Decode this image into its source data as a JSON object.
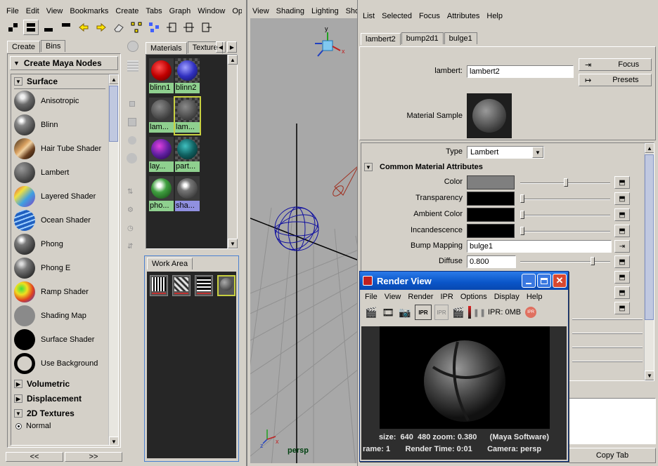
{
  "hypershade": {
    "menu": [
      "File",
      "Edit",
      "View",
      "Bookmarks",
      "Create",
      "Tabs",
      "Graph",
      "Window",
      "Opti"
    ],
    "left_tabs": [
      "Create",
      "Bins"
    ],
    "create_header": "Create Maya Nodes",
    "sections": {
      "surface": "Surface",
      "volumetric": "Volumetric",
      "displacement": "Displacement",
      "textures2d": "2D Textures"
    },
    "nodes": [
      {
        "label": "Anisotropic",
        "icon": "anisotropic-icon"
      },
      {
        "label": "Blinn",
        "icon": "blinn-icon"
      },
      {
        "label": "Hair Tube Shader",
        "icon": "hair-tube-shader-icon"
      },
      {
        "label": "Lambert",
        "icon": "lambert-icon"
      },
      {
        "label": "Layered Shader",
        "icon": "layered-shader-icon"
      },
      {
        "label": "Ocean Shader",
        "icon": "ocean-shader-icon"
      },
      {
        "label": "Phong",
        "icon": "phong-icon"
      },
      {
        "label": "Phong E",
        "icon": "phong-e-icon"
      },
      {
        "label": "Ramp Shader",
        "icon": "ramp-shader-icon"
      },
      {
        "label": "Shading Map",
        "icon": "shading-map-icon"
      },
      {
        "label": "Surface Shader",
        "icon": "surface-shader-icon"
      },
      {
        "label": "Use Background",
        "icon": "use-background-icon"
      }
    ],
    "normal_radio": "Normal",
    "nav_prev": "<<",
    "nav_next": ">>",
    "mat_tabs": [
      "Materials",
      "Texture"
    ],
    "materials": [
      "blinn1",
      "blinn2",
      "lam...",
      "lam...",
      "lay...",
      "part...",
      "pho...",
      "sha..."
    ],
    "work_area_tab": "Work Area"
  },
  "viewport": {
    "menu": [
      "View",
      "Shading",
      "Lighting",
      "Sho"
    ],
    "camera_label": "persp"
  },
  "attr_editor": {
    "menu": [
      "List",
      "Selected",
      "Focus",
      "Attributes",
      "Help"
    ],
    "tabs": [
      "lambert2",
      "bump2d1",
      "bulge1"
    ],
    "node_type_label": "lambert:",
    "node_name": "lambert2",
    "focus_btn": "Focus",
    "presets_btn": "Presets",
    "sample_label": "Material Sample",
    "type_label": "Type",
    "type_value": "Lambert",
    "section": "Common Material Attributes",
    "attrs": [
      {
        "label": "Color",
        "swatch": "#7f7f7f",
        "slider": 0.5
      },
      {
        "label": "Transparency",
        "swatch": "#000000",
        "slider": 0.0
      },
      {
        "label": "Ambient Color",
        "swatch": "#000000",
        "slider": 0.0
      },
      {
        "label": "Incandescence",
        "swatch": "#000000",
        "slider": 0.0
      }
    ],
    "bump_label": "Bump Mapping",
    "bump_value": "bulge1",
    "diffuse_label": "Diffuse",
    "diffuse_value": "0.800",
    "copy_tab": "Copy Tab"
  },
  "render_view": {
    "title": "Render View",
    "menu": [
      "File",
      "View",
      "Render",
      "IPR",
      "Options",
      "Display",
      "Help"
    ],
    "ipr_status": "IPR: 0MB",
    "info_line1": "size:  640  480 zoom: 0.380      (Maya Software)",
    "info_line2": "rame: 1       Render Time: 0:01       Camera: persp"
  },
  "colors": {
    "window_bg": "#d4d0c8",
    "viewport_bg": "#a8a8a8",
    "titlebar": "#0a55c8",
    "material_label": "#8fd08f"
  }
}
